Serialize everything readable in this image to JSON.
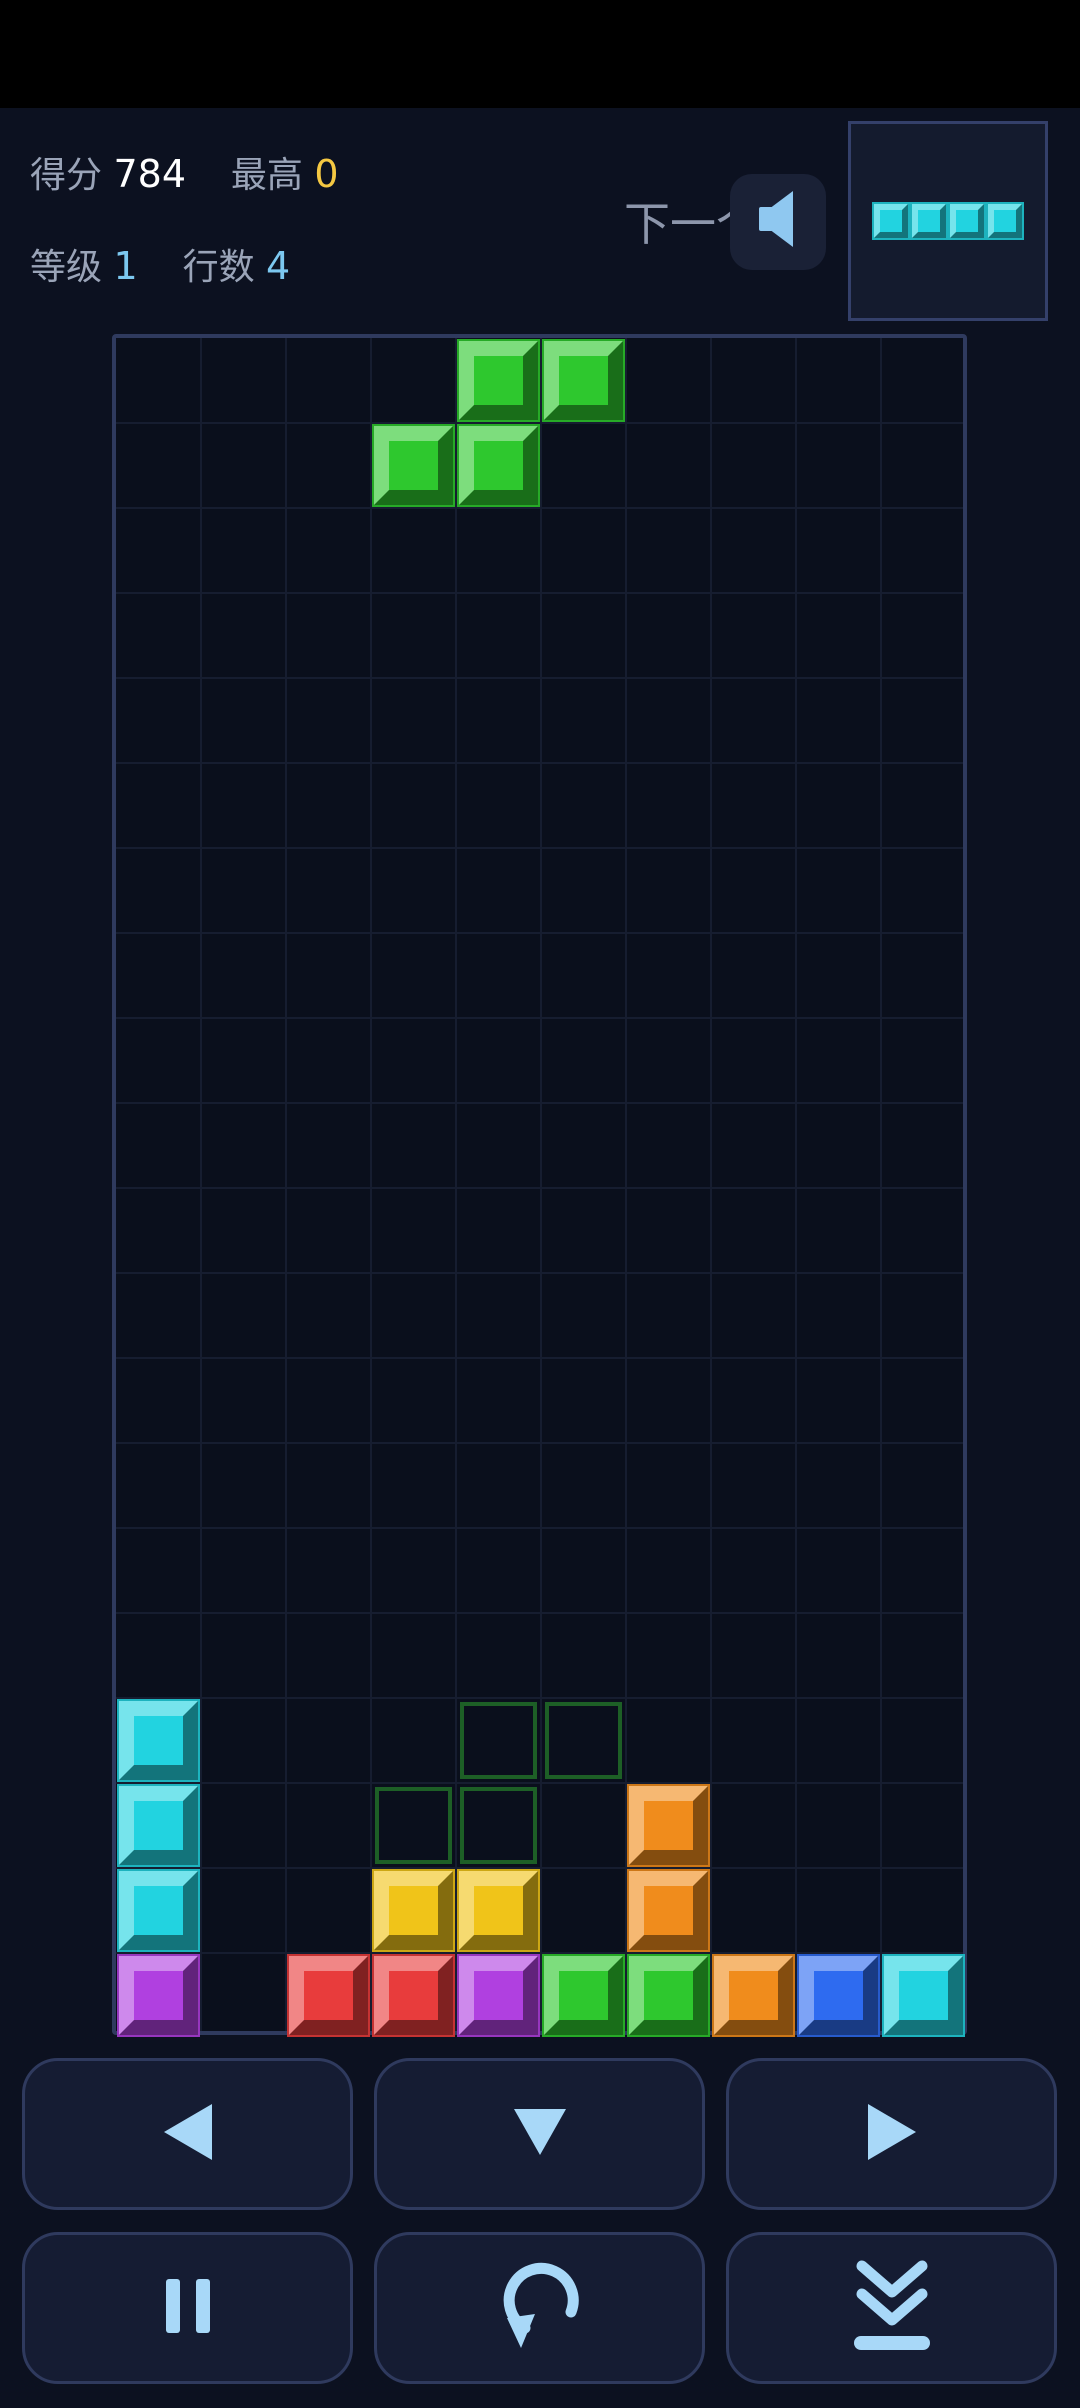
{
  "stats": {
    "score_label": "得分",
    "score_value": "784",
    "best_label": "最高",
    "best_value": "0",
    "level_label": "等级",
    "level_value": "1",
    "lines_label": "行数",
    "lines_value": "4"
  },
  "next": {
    "label": "下一个",
    "piece": "I",
    "orientation": "horizontal"
  },
  "icons": {
    "sound": "speaker-icon",
    "move_left": "triangle-left-icon",
    "soft_drop": "triangle-down-icon",
    "move_right": "triangle-right-icon",
    "pause": "pause-icon",
    "rotate": "rotate-icon",
    "hard_drop": "double-chevron-down-icon"
  },
  "colors": {
    "accent_score": "#ffffff",
    "accent_best": "#f5c842",
    "accent_level": "#7cc8f0",
    "I": "#22d3e0",
    "O": "#f0c419",
    "T": "#b040e0",
    "S": "#2ec82e",
    "Z": "#e83c3c",
    "J": "#2e6bf0",
    "L": "#f08c1c",
    "ghost": "#1d5f26"
  },
  "board": {
    "cols": 10,
    "rows": 20,
    "active_piece": {
      "type": "S",
      "cells": [
        [
          4,
          0
        ],
        [
          5,
          0
        ],
        [
          3,
          1
        ],
        [
          4,
          1
        ]
      ]
    },
    "ghost_cells": [
      [
        4,
        16
      ],
      [
        5,
        16
      ],
      [
        3,
        17
      ],
      [
        4,
        17
      ]
    ],
    "locked": [
      {
        "col": 0,
        "row": 16,
        "type": "I"
      },
      {
        "col": 0,
        "row": 17,
        "type": "I"
      },
      {
        "col": 0,
        "row": 18,
        "type": "I"
      },
      {
        "col": 0,
        "row": 19,
        "type": "T"
      },
      {
        "col": 2,
        "row": 19,
        "type": "Z"
      },
      {
        "col": 3,
        "row": 19,
        "type": "Z"
      },
      {
        "col": 4,
        "row": 19,
        "type": "T"
      },
      {
        "col": 5,
        "row": 19,
        "type": "S"
      },
      {
        "col": 6,
        "row": 19,
        "type": "S"
      },
      {
        "col": 7,
        "row": 19,
        "type": "L"
      },
      {
        "col": 8,
        "row": 19,
        "type": "J"
      },
      {
        "col": 9,
        "row": 19,
        "type": "I"
      },
      {
        "col": 3,
        "row": 18,
        "type": "O"
      },
      {
        "col": 4,
        "row": 18,
        "type": "O"
      },
      {
        "col": 6,
        "row": 17,
        "type": "L"
      },
      {
        "col": 6,
        "row": 18,
        "type": "L"
      }
    ]
  }
}
